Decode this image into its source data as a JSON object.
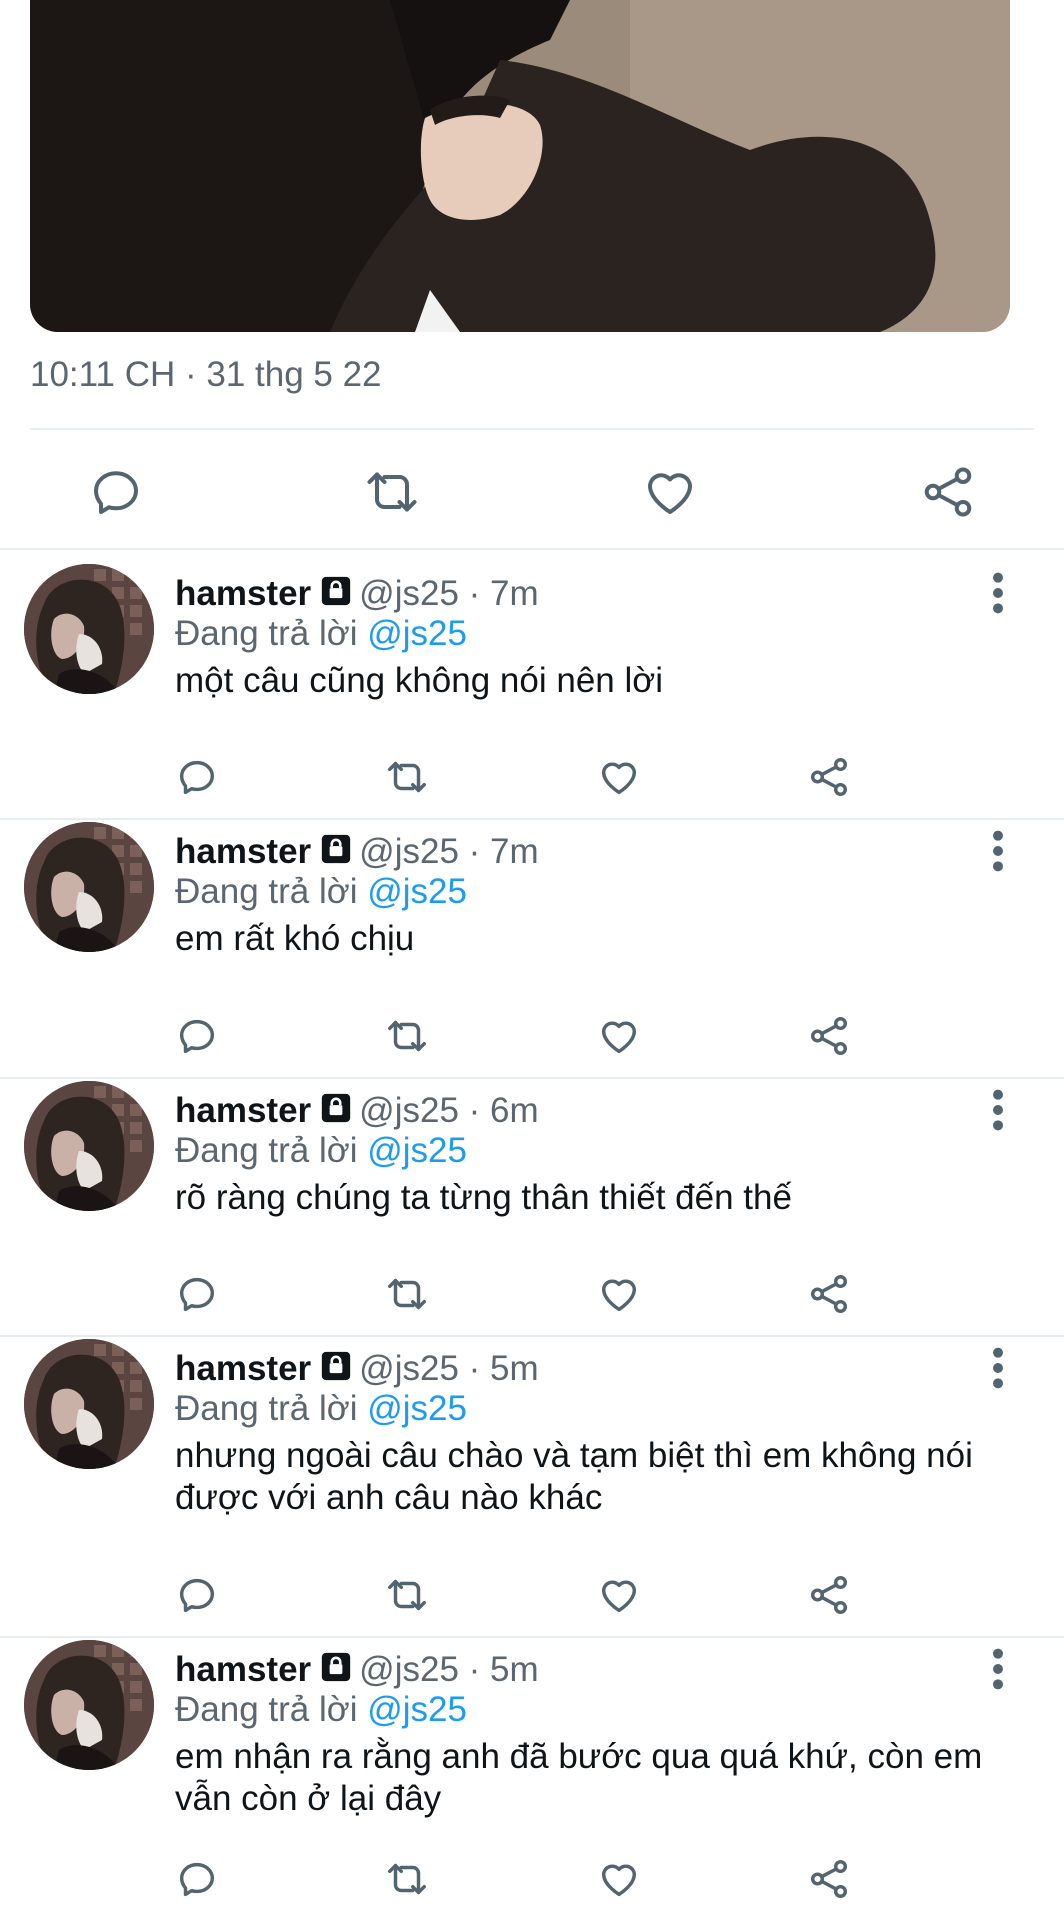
{
  "tweet": {
    "timestamp": "10:11 CH · 31 thg 5 22"
  },
  "main_actions": [
    "reply-icon",
    "retweet-icon",
    "like-icon",
    "share-icon"
  ],
  "colors": {
    "link": "#1d9bf0",
    "secondary_text": "#5b6670",
    "divider": "#e6ecf0"
  },
  "replies": [
    {
      "name": "hamster",
      "handle": "@js25",
      "dot": "·",
      "time": "7m",
      "replying_prefix": "Đang trả lời",
      "replying_to": "@js25",
      "text": "một câu cũng không nói nên lời"
    },
    {
      "name": "hamster",
      "handle": "@js25",
      "dot": "·",
      "time": "7m",
      "replying_prefix": "Đang trả lời",
      "replying_to": "@js25",
      "text": "em rất khó chịu"
    },
    {
      "name": "hamster",
      "handle": "@js25",
      "dot": "·",
      "time": "6m",
      "replying_prefix": "Đang trả lời",
      "replying_to": "@js25",
      "text": "rõ ràng chúng ta từng thân thiết đến thế"
    },
    {
      "name": "hamster",
      "handle": "@js25",
      "dot": "·",
      "time": "5m",
      "replying_prefix": "Đang trả lời",
      "replying_to": "@js25",
      "text": "nhưng ngoài câu chào và tạm biệt thì em không nói được với anh câu nào khác"
    },
    {
      "name": "hamster",
      "handle": "@js25",
      "dot": "·",
      "time": "5m",
      "replying_prefix": "Đang trả lời",
      "replying_to": "@js25",
      "text": "em nhận ra rằng anh đã bước qua quá khứ, còn em vẫn còn ở lại đây"
    }
  ]
}
